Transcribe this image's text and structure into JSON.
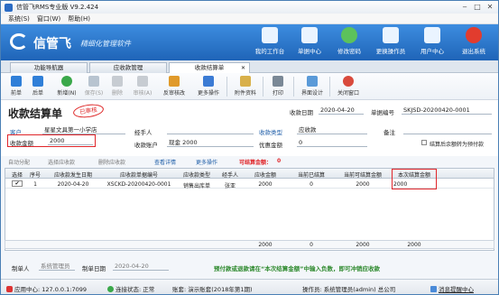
{
  "window": {
    "title": "信管飞RMS专业版 V9.2.424"
  },
  "menu": [
    "系统(S)",
    "窗口(W)",
    "帮助(H)"
  ],
  "banner": {
    "logo": "信管飞",
    "slogan": "精细化管理软件",
    "nav": [
      "我的工作台",
      "单据中心",
      "修改密码",
      "更换操作员",
      "用户中心",
      "退出系统"
    ]
  },
  "tabs": [
    "功能导航器",
    "应收款管理",
    "收款结算单"
  ],
  "toolbar": [
    "前单",
    "后单",
    "新增(N)",
    "保存(S)",
    "删除",
    "审核(A)",
    "反审核改",
    "更多操作",
    "附件资料",
    "打印",
    "界面设计",
    "关闭窗口"
  ],
  "form": {
    "doc_title": "收款结算单",
    "stamp": "已审核",
    "date_label": "收款日期",
    "date_value": "2020-04-20",
    "no_label": "单据编号",
    "no_value": "SKJSD-20200420-0001",
    "customer_label": "客户",
    "customer_value": "星星文具第一小学店",
    "handler_label": "经手人",
    "receipt_type_label": "收款类型",
    "receipt_type_value": "应收款",
    "remark_label": "备注",
    "amount_label": "收款金额",
    "amount_value": "2000",
    "account_label": "收款账户",
    "account_value": "现金 2000",
    "discount_label": "优惠金额",
    "discount_value": "0",
    "settle_option": "结算后余额转为预付款"
  },
  "subbar": {
    "items": [
      "自动分配",
      "选择应收款",
      "删除应收款",
      "查看详情",
      "更多操作"
    ],
    "settle_amount_label": "可结算金额：",
    "settle_amount_value": "0"
  },
  "grid": {
    "headers": [
      "选择",
      "序号",
      "应收款发生日期",
      "应收款单据编号",
      "应收款类型",
      "经手人",
      "应收金额",
      "当前已结算",
      "当前可结算金额",
      "本次结算金额"
    ],
    "rows": [
      [
        "✔",
        "1",
        "2020-04-20",
        "XSCKD-20200420-0001",
        "销售出库单",
        "张亚",
        "2000",
        "0",
        "2000",
        "2000"
      ]
    ],
    "footer": [
      "2000",
      "0",
      "2000",
      "2000"
    ]
  },
  "bottom": {
    "maker_label": "制单人",
    "maker_value": "系统管理员",
    "make_date_label": "制单日期",
    "make_date_value": "2020-04-20",
    "hint": "预付款或退款请在“本次结算金额”中输入负数，即可冲销应收款"
  },
  "status": {
    "center": "应用中心: 127.0.0.1:7099",
    "connect": "连接状态: 正常",
    "ledger": "账套: 演示账套(2018年第1期)",
    "operator": "操作员: 系统管理员(admin) 总公司",
    "message": "消息提醒中心"
  }
}
